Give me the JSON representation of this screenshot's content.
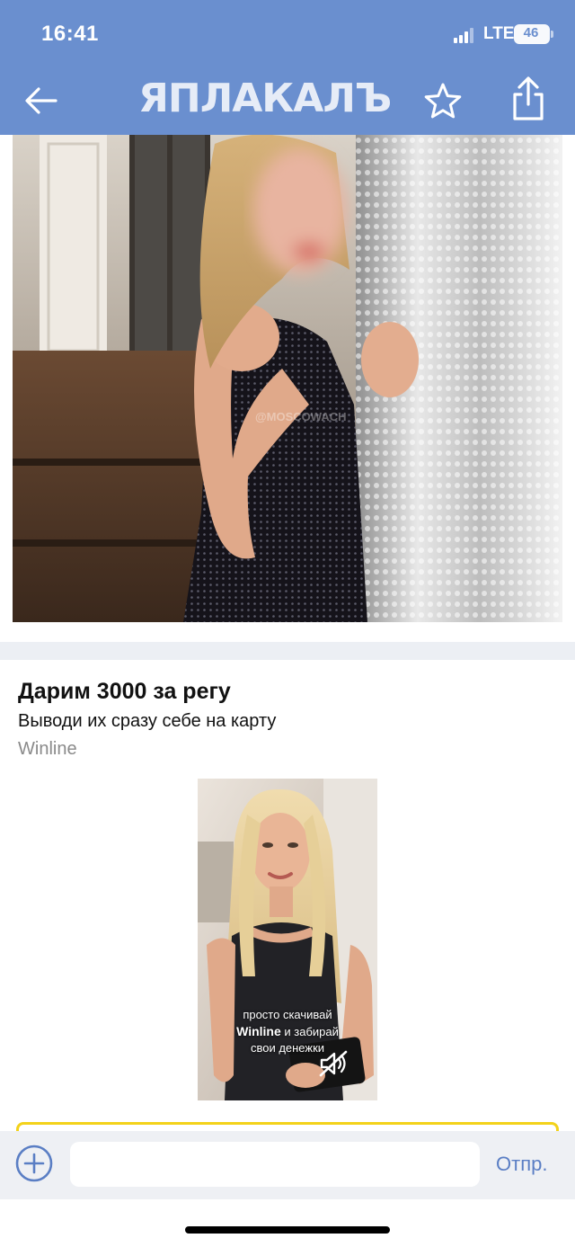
{
  "status_bar": {
    "time": "16:41",
    "network": "LTE",
    "battery_level": "46"
  },
  "nav": {
    "logo_text": "ЯПЛАКАЛЪ",
    "icons": [
      "back-arrow-icon",
      "star-icon",
      "share-icon"
    ]
  },
  "post": {
    "photo_watermark": "@MOSCOWACH"
  },
  "ad": {
    "title": "Дарим 3000 за регу",
    "subtitle": "Выводи их сразу себе на карту",
    "brand": "Winline",
    "video_caption_line1": "просто скачивай",
    "video_caption_brand": "Winline",
    "video_caption_line2": " и забирай",
    "video_caption_line3": "свои денежки",
    "accent_color": "#f3d21a"
  },
  "composer": {
    "input_value": "",
    "send_label": "Отпр."
  },
  "colors": {
    "header": "#6a8fcf",
    "link": "#5a7ec4"
  }
}
